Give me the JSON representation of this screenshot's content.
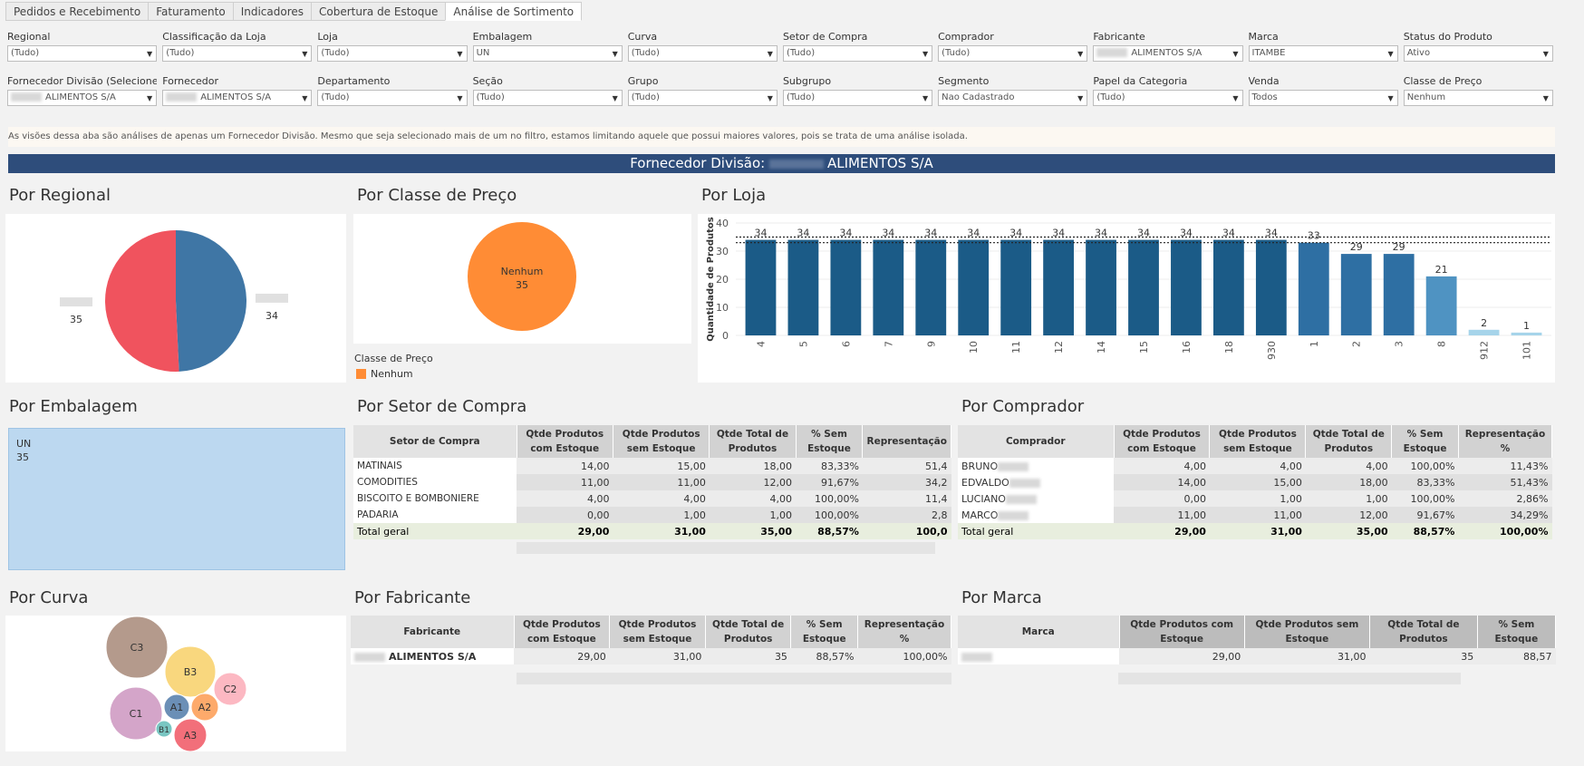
{
  "tabs": [
    "Pedidos e Recebimento",
    "Faturamento",
    "Indicadores",
    "Cobertura de Estoque",
    "Análise de Sortimento"
  ],
  "active_tab": 4,
  "filters_row1": [
    {
      "label": "Regional",
      "value": "(Tudo)"
    },
    {
      "label": "Classificação da Loja",
      "value": "(Tudo)"
    },
    {
      "label": "Loja",
      "value": "(Tudo)"
    },
    {
      "label": "Embalagem",
      "value": "UN"
    },
    {
      "label": "Curva",
      "value": "(Tudo)"
    },
    {
      "label": "Setor de Compra",
      "value": "(Tudo)"
    },
    {
      "label": "Comprador",
      "value": "(Tudo)"
    },
    {
      "label": "Fabricante",
      "value": "ALIMENTOS S/A"
    },
    {
      "label": "Marca",
      "value": "ITAMBE"
    },
    {
      "label": "Status do Produto",
      "value": "Ativo"
    }
  ],
  "filters_row2": [
    {
      "label": "Fornecedor Divisão (Selecione)",
      "value": "ALIMENTOS S/A"
    },
    {
      "label": "Fornecedor",
      "value": "ALIMENTOS S/A"
    },
    {
      "label": "Departamento",
      "value": "(Tudo)"
    },
    {
      "label": "Seção",
      "value": "(Tudo)"
    },
    {
      "label": "Grupo",
      "value": "(Tudo)"
    },
    {
      "label": "Subgrupo",
      "value": "(Tudo)"
    },
    {
      "label": "Segmento",
      "value": "Nao Cadastrado"
    },
    {
      "label": "Papel da Categoria",
      "value": "(Tudo)"
    },
    {
      "label": "Venda",
      "value": "Todos"
    },
    {
      "label": "Classe de Preço",
      "value": "Nenhum"
    }
  ],
  "note": "As visões dessa aba são análises de apenas um Fornecedor Divisão. Mesmo que seja selecionado mais de um no filtro, estamos limitando aquele que possui maiores valores, pois se trata de uma análise isolada.",
  "banner": {
    "prefix": "Fornecedor Divisão:",
    "suffix": "ALIMENTOS S/A"
  },
  "titles": {
    "regional": "Por Regional",
    "classe": "Por Classe de Preço",
    "loja": "Por Loja",
    "embalagem": "Por Embalagem",
    "setor": "Por Setor de Compra",
    "comprador": "Por Comprador",
    "curva": "Por Curva",
    "fabricante": "Por Fabricante",
    "marca": "Por Marca"
  },
  "chart_data": [
    {
      "type": "pie",
      "id": "regional",
      "slices": [
        {
          "label": "",
          "value": 34,
          "color": "#3f76a5"
        },
        {
          "label": "",
          "value": 35,
          "color": "#f0535e"
        }
      ]
    },
    {
      "type": "pie",
      "id": "classe",
      "slices": [
        {
          "label": "Nenhum",
          "value": 35,
          "color": "#ff8c35"
        }
      ],
      "legend_title": "Classe de Preço",
      "legend": [
        {
          "label": "Nenhum",
          "color": "#ff8c35"
        }
      ]
    },
    {
      "type": "bar",
      "id": "loja",
      "ylabel": "Quantidade de Produtos",
      "ylim": [
        0,
        40
      ],
      "yticks": [
        0,
        10,
        20,
        30,
        40
      ],
      "categories": [
        "4",
        "5",
        "6",
        "7",
        "9",
        "10",
        "11",
        "12",
        "14",
        "15",
        "16",
        "18",
        "930",
        "1",
        "2",
        "3",
        "8",
        "912",
        "101"
      ],
      "values": [
        34,
        34,
        34,
        34,
        34,
        34,
        34,
        34,
        34,
        34,
        34,
        34,
        34,
        33,
        29,
        29,
        21,
        2,
        1
      ],
      "reference_lines": [
        33,
        35
      ]
    },
    {
      "type": "bubble",
      "id": "curva",
      "items": [
        {
          "label": "C3",
          "color": "#b49a8c"
        },
        {
          "label": "B3",
          "color": "#f9d77e"
        },
        {
          "label": "C2",
          "color": "#fcb8c2"
        },
        {
          "label": "C1",
          "color": "#d4a5c9"
        },
        {
          "label": "A1",
          "color": "#6b8fb6"
        },
        {
          "label": "A2",
          "color": "#fdaa6b"
        },
        {
          "label": "B1",
          "color": "#79c6c2"
        },
        {
          "label": "A3",
          "color": "#f26f7a"
        }
      ]
    }
  ],
  "embalagem": {
    "label": "UN",
    "value": "35"
  },
  "setor_table": {
    "headers": [
      "Setor de Compra",
      "Qtde Produtos com Estoque",
      "Qtde Produtos sem Estoque",
      "Qtde Total de Produtos",
      "% Sem Estoque",
      "Representação"
    ],
    "rows": [
      [
        "MATINAIS",
        "14,00",
        "15,00",
        "18,00",
        "83,33%",
        "51,4"
      ],
      [
        "COMODITIES",
        "11,00",
        "11,00",
        "12,00",
        "91,67%",
        "34,2"
      ],
      [
        "BISCOITO E BOMBONIERE",
        "4,00",
        "4,00",
        "4,00",
        "100,00%",
        "11,4"
      ],
      [
        "PADARIA",
        "0,00",
        "1,00",
        "1,00",
        "100,00%",
        "2,8"
      ]
    ],
    "total": [
      "Total geral",
      "29,00",
      "31,00",
      "35,00",
      "88,57%",
      "100,0"
    ]
  },
  "comprador_table": {
    "headers": [
      "Comprador",
      "Qtde Produtos com Estoque",
      "Qtde Produtos sem Estoque",
      "Qtde Total de Produtos",
      "% Sem Estoque",
      "Representação %"
    ],
    "rows": [
      [
        "BRUNO",
        "4,00",
        "4,00",
        "4,00",
        "100,00%",
        "11,43%"
      ],
      [
        "EDVALDO",
        "14,00",
        "15,00",
        "18,00",
        "83,33%",
        "51,43%"
      ],
      [
        "LUCIANO",
        "0,00",
        "1,00",
        "1,00",
        "100,00%",
        "2,86%"
      ],
      [
        "MARCO",
        "11,00",
        "11,00",
        "12,00",
        "91,67%",
        "34,29%"
      ]
    ],
    "total": [
      "Total geral",
      "29,00",
      "31,00",
      "35,00",
      "88,57%",
      "100,00%"
    ]
  },
  "fabricante_table": {
    "headers": [
      "Fabricante",
      "Qtde Produtos com Estoque",
      "Qtde Produtos sem Estoque",
      "Qtde Total de Produtos",
      "% Sem Estoque",
      "Representação %"
    ],
    "rows": [
      [
        "ALIMENTOS S/A",
        "29,00",
        "31,00",
        "35",
        "88,57%",
        "100,00%"
      ]
    ]
  },
  "marca_table": {
    "headers": [
      "Marca",
      "Qtde Produtos com Estoque",
      "Qtde Produtos sem Estoque",
      "Qtde Total de Produtos",
      "% Sem Estoque"
    ],
    "rows": [
      [
        "",
        "29,00",
        "31,00",
        "35",
        "88,57"
      ]
    ]
  }
}
